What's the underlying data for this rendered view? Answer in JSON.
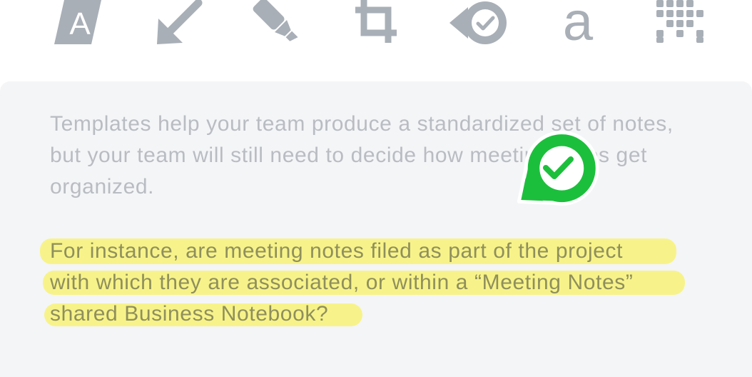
{
  "toolbar": {
    "tools": [
      {
        "icon": "text-tool-icon",
        "label": "A"
      },
      {
        "icon": "arrow-tool-icon"
      },
      {
        "icon": "highlighter-tool-icon"
      },
      {
        "icon": "crop-tool-icon"
      },
      {
        "icon": "stamp-tool-icon"
      },
      {
        "icon": "type-tool-icon",
        "label": "a"
      },
      {
        "icon": "pixelate-tool-icon"
      }
    ],
    "icon_color": "#a9afb7"
  },
  "note": {
    "paragraph_1": "Templates help your team produce a standardized set of notes, but your team will still need to decide how meeting notes get organized.",
    "paragraph_2_lines": [
      "For instance, are meeting notes filed as part of the project",
      "with which they are associated, or within a “Meeting Notes”",
      "shared Business Notebook?"
    ],
    "highlight_color": "#f7f38a",
    "stamp_color": "#1cbf3c"
  }
}
